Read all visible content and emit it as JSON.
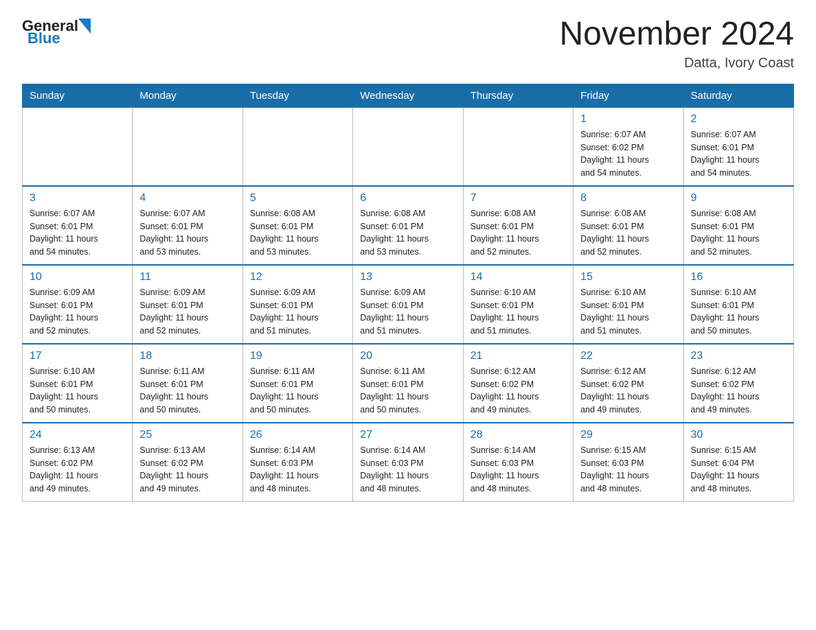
{
  "header": {
    "logo_general": "General",
    "logo_blue": "Blue",
    "month_title": "November 2024",
    "location": "Datta, Ivory Coast"
  },
  "days_of_week": [
    "Sunday",
    "Monday",
    "Tuesday",
    "Wednesday",
    "Thursday",
    "Friday",
    "Saturday"
  ],
  "weeks": [
    {
      "days": [
        {
          "number": "",
          "info": ""
        },
        {
          "number": "",
          "info": ""
        },
        {
          "number": "",
          "info": ""
        },
        {
          "number": "",
          "info": ""
        },
        {
          "number": "",
          "info": ""
        },
        {
          "number": "1",
          "info": "Sunrise: 6:07 AM\nSunset: 6:02 PM\nDaylight: 11 hours\nand 54 minutes."
        },
        {
          "number": "2",
          "info": "Sunrise: 6:07 AM\nSunset: 6:01 PM\nDaylight: 11 hours\nand 54 minutes."
        }
      ]
    },
    {
      "days": [
        {
          "number": "3",
          "info": "Sunrise: 6:07 AM\nSunset: 6:01 PM\nDaylight: 11 hours\nand 54 minutes."
        },
        {
          "number": "4",
          "info": "Sunrise: 6:07 AM\nSunset: 6:01 PM\nDaylight: 11 hours\nand 53 minutes."
        },
        {
          "number": "5",
          "info": "Sunrise: 6:08 AM\nSunset: 6:01 PM\nDaylight: 11 hours\nand 53 minutes."
        },
        {
          "number": "6",
          "info": "Sunrise: 6:08 AM\nSunset: 6:01 PM\nDaylight: 11 hours\nand 53 minutes."
        },
        {
          "number": "7",
          "info": "Sunrise: 6:08 AM\nSunset: 6:01 PM\nDaylight: 11 hours\nand 52 minutes."
        },
        {
          "number": "8",
          "info": "Sunrise: 6:08 AM\nSunset: 6:01 PM\nDaylight: 11 hours\nand 52 minutes."
        },
        {
          "number": "9",
          "info": "Sunrise: 6:08 AM\nSunset: 6:01 PM\nDaylight: 11 hours\nand 52 minutes."
        }
      ]
    },
    {
      "days": [
        {
          "number": "10",
          "info": "Sunrise: 6:09 AM\nSunset: 6:01 PM\nDaylight: 11 hours\nand 52 minutes."
        },
        {
          "number": "11",
          "info": "Sunrise: 6:09 AM\nSunset: 6:01 PM\nDaylight: 11 hours\nand 52 minutes."
        },
        {
          "number": "12",
          "info": "Sunrise: 6:09 AM\nSunset: 6:01 PM\nDaylight: 11 hours\nand 51 minutes."
        },
        {
          "number": "13",
          "info": "Sunrise: 6:09 AM\nSunset: 6:01 PM\nDaylight: 11 hours\nand 51 minutes."
        },
        {
          "number": "14",
          "info": "Sunrise: 6:10 AM\nSunset: 6:01 PM\nDaylight: 11 hours\nand 51 minutes."
        },
        {
          "number": "15",
          "info": "Sunrise: 6:10 AM\nSunset: 6:01 PM\nDaylight: 11 hours\nand 51 minutes."
        },
        {
          "number": "16",
          "info": "Sunrise: 6:10 AM\nSunset: 6:01 PM\nDaylight: 11 hours\nand 50 minutes."
        }
      ]
    },
    {
      "days": [
        {
          "number": "17",
          "info": "Sunrise: 6:10 AM\nSunset: 6:01 PM\nDaylight: 11 hours\nand 50 minutes."
        },
        {
          "number": "18",
          "info": "Sunrise: 6:11 AM\nSunset: 6:01 PM\nDaylight: 11 hours\nand 50 minutes."
        },
        {
          "number": "19",
          "info": "Sunrise: 6:11 AM\nSunset: 6:01 PM\nDaylight: 11 hours\nand 50 minutes."
        },
        {
          "number": "20",
          "info": "Sunrise: 6:11 AM\nSunset: 6:01 PM\nDaylight: 11 hours\nand 50 minutes."
        },
        {
          "number": "21",
          "info": "Sunrise: 6:12 AM\nSunset: 6:02 PM\nDaylight: 11 hours\nand 49 minutes."
        },
        {
          "number": "22",
          "info": "Sunrise: 6:12 AM\nSunset: 6:02 PM\nDaylight: 11 hours\nand 49 minutes."
        },
        {
          "number": "23",
          "info": "Sunrise: 6:12 AM\nSunset: 6:02 PM\nDaylight: 11 hours\nand 49 minutes."
        }
      ]
    },
    {
      "days": [
        {
          "number": "24",
          "info": "Sunrise: 6:13 AM\nSunset: 6:02 PM\nDaylight: 11 hours\nand 49 minutes."
        },
        {
          "number": "25",
          "info": "Sunrise: 6:13 AM\nSunset: 6:02 PM\nDaylight: 11 hours\nand 49 minutes."
        },
        {
          "number": "26",
          "info": "Sunrise: 6:14 AM\nSunset: 6:03 PM\nDaylight: 11 hours\nand 48 minutes."
        },
        {
          "number": "27",
          "info": "Sunrise: 6:14 AM\nSunset: 6:03 PM\nDaylight: 11 hours\nand 48 minutes."
        },
        {
          "number": "28",
          "info": "Sunrise: 6:14 AM\nSunset: 6:03 PM\nDaylight: 11 hours\nand 48 minutes."
        },
        {
          "number": "29",
          "info": "Sunrise: 6:15 AM\nSunset: 6:03 PM\nDaylight: 11 hours\nand 48 minutes."
        },
        {
          "number": "30",
          "info": "Sunrise: 6:15 AM\nSunset: 6:04 PM\nDaylight: 11 hours\nand 48 minutes."
        }
      ]
    }
  ]
}
